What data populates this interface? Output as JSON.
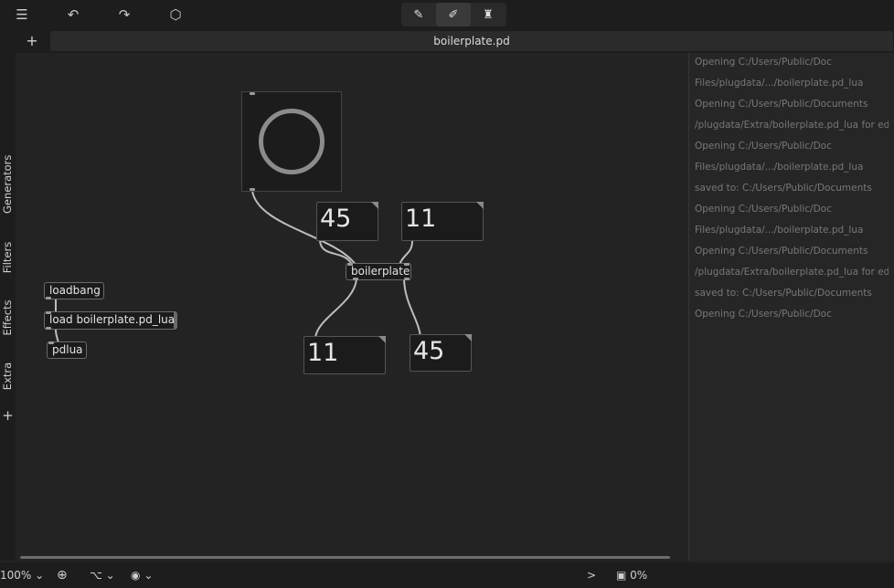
{
  "toolbar": {
    "menu_icon": "☰",
    "undo_icon": "↶",
    "redo_icon": "↷",
    "add_object_icon": "⬡",
    "edit_modes": [
      {
        "name": "edit-mode-pencil",
        "icon": "✎",
        "active": false
      },
      {
        "name": "edit-mode-run",
        "icon": "✐",
        "active": true
      },
      {
        "name": "edit-mode-present",
        "icon": "♜",
        "active": false
      }
    ]
  },
  "tabs": {
    "add_label": "+",
    "active_title": "boilerplate.pd"
  },
  "sidebar": {
    "items": [
      {
        "label": "Generators"
      },
      {
        "label": "Filters"
      },
      {
        "label": "Effects"
      },
      {
        "label": "Extra"
      }
    ],
    "add_label": "+"
  },
  "patch": {
    "loadbang": "loadbang",
    "load_msg": "load boilerplate.pd_lua",
    "pdlua": "pdlua",
    "boilerplate": "boilerplate",
    "num_in_left": "45",
    "num_in_right": "11",
    "num_out_left": "11",
    "num_out_right": "45"
  },
  "console": {
    "lines": [
      "Opening C:/Users/Public/Doc",
      "Files/plugdata/.../boilerplate.pd_lua",
      "Opening C:/Users/Public/Documents",
      "/plugdata/Extra/boilerplate.pd_lua for editing",
      "Opening C:/Users/Public/Doc",
      "Files/plugdata/.../boilerplate.pd_lua",
      "saved to: C:/Users/Public/Documents",
      "Opening C:/Users/Public/Doc",
      "Files/plugdata/.../boilerplate.pd_lua",
      "Opening C:/Users/Public/Documents",
      "/plugdata/Extra/boilerplate.pd_lua for editing",
      "saved to: C:/Users/Public/Documents",
      "Opening C:/Users/Public/Doc"
    ]
  },
  "status": {
    "zoom": "100%",
    "chevron": "⌄",
    "crosshair_icon": "⊕",
    "connection_icon": "⌥",
    "eye_icon": "◉",
    "console_prompt": ">",
    "cpu": "0%"
  }
}
